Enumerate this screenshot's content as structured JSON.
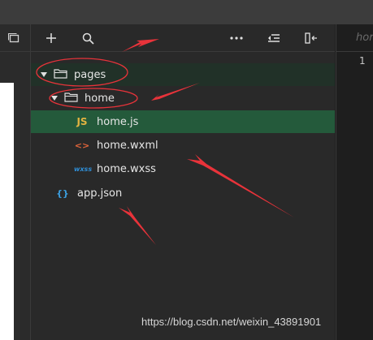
{
  "toolbar": {
    "left_icon": "window-icon",
    "add_icon": "plus-icon",
    "search_icon": "search-icon",
    "more_icon": "more-icon",
    "collapse_icon": "collapse-icon",
    "split_icon": "split-icon"
  },
  "tree": {
    "pages": "pages",
    "home": "home",
    "files": [
      {
        "icon": "JS",
        "label": "home.js",
        "color": "#e3b341"
      },
      {
        "icon": "<>",
        "label": "home.wxml",
        "color": "#e0643a"
      },
      {
        "icon": "wxss",
        "label": "home.wxss",
        "color": "#2f8fd8"
      }
    ],
    "app_json": {
      "icon": "{}",
      "label": "app.json",
      "color": "#3b9fe0"
    }
  },
  "editor": {
    "tab_label": "hor",
    "line_number": "1"
  },
  "watermark": "https://blog.csdn.net/weixin_43891901",
  "colors": {
    "annotation": "#e8333a",
    "selected_row": "#245a3b"
  }
}
